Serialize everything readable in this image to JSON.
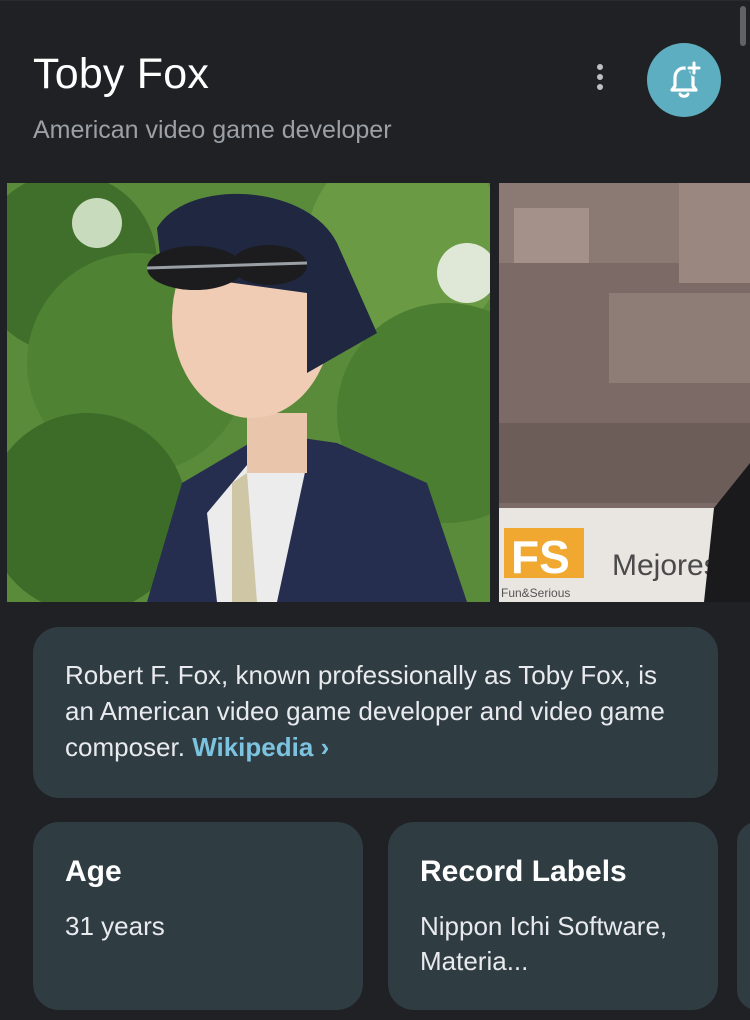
{
  "entity": {
    "name": "Toby Fox",
    "subtitle": "American video game developer"
  },
  "icons": {
    "more": "more-vert-icon",
    "follow": "bell-add-icon",
    "link_arrow": "chevron-right-icon"
  },
  "colors": {
    "background": "#202124",
    "card": "#2f3c42",
    "accent": "#5eaec2",
    "link": "#7cc3e0"
  },
  "photos": {
    "second_sign_text": "Mejores v",
    "second_logo_text": "FS",
    "second_logo_caption": "Fun&Serious"
  },
  "description": {
    "text": "Robert F. Fox, known professionally as Toby Fox, is an American video game developer and video game composer.",
    "source": "Wikipedia",
    "source_arrow": "›"
  },
  "facts": [
    {
      "label": "Age",
      "value": "31 years"
    },
    {
      "label": "Record Labels",
      "value": "Nippon Ichi Software, Materia..."
    }
  ]
}
